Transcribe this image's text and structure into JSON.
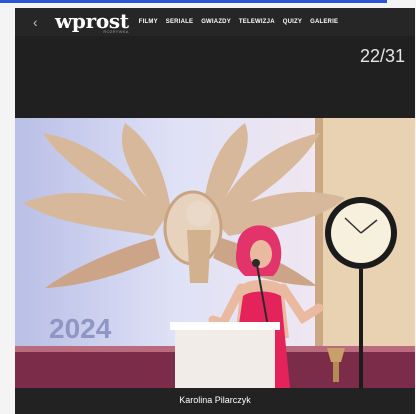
{
  "header": {
    "back_icon": "‹",
    "logo_text": "wprost",
    "logo_subtext": "ROZRYWKA",
    "menu": [
      "FILMY",
      "SERIALE",
      "GWIAZDY",
      "TELEWIZJA",
      "QUIZY",
      "GALERIE"
    ]
  },
  "gallery": {
    "counter": "22/31",
    "photo_year_text": "2024",
    "caption": "Karolina Pilarczyk"
  },
  "colors": {
    "nav_bg": "#262626",
    "content_bg": "#202020",
    "link_line": "#2a55d6"
  }
}
